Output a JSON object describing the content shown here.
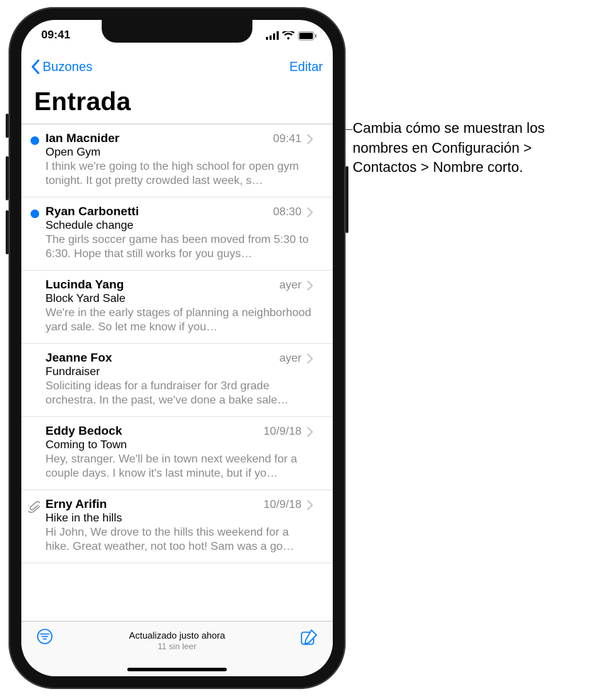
{
  "status": {
    "time": "09:41"
  },
  "nav": {
    "back": "Buzones",
    "edit": "Editar"
  },
  "title": "Entrada",
  "messages": [
    {
      "sender": "Ian Macnider",
      "time": "09:41",
      "subject": "Open Gym",
      "preview": "I think we're going to the high school for open gym tonight. It got pretty crowded last week, s…",
      "unread": true,
      "attachment": false
    },
    {
      "sender": "Ryan Carbonetti",
      "time": "08:30",
      "subject": "Schedule change",
      "preview": "The girls soccer game has been moved from 5:30 to 6:30. Hope that still works for you guys…",
      "unread": true,
      "attachment": false
    },
    {
      "sender": "Lucinda Yang",
      "time": "ayer",
      "subject": "Block Yard Sale",
      "preview": "We're in the early stages of planning a neighborhood yard sale. So let me know if you…",
      "unread": false,
      "attachment": false
    },
    {
      "sender": "Jeanne Fox",
      "time": "ayer",
      "subject": "Fundraiser",
      "preview": "Soliciting ideas for a fundraiser for 3rd grade orchestra. In the past, we've done a bake sale…",
      "unread": false,
      "attachment": false
    },
    {
      "sender": "Eddy Bedock",
      "time": "10/9/18",
      "subject": "Coming to Town",
      "preview": "Hey, stranger. We'll be in town next weekend for a couple days. I know it's last minute, but if yo…",
      "unread": false,
      "attachment": false
    },
    {
      "sender": "Erny Arifin",
      "time": "10/9/18",
      "subject": "Hike in the hills",
      "preview": "Hi John, We drove to the hills this weekend for a hike. Great weather, not too hot! Sam was a go…",
      "unread": false,
      "attachment": true
    }
  ],
  "toolbar": {
    "status": "Actualizado justo ahora",
    "substatus": "11 sin leer"
  },
  "callout": "Cambia cómo se muestran los nombres en Configuración > Contactos > Nombre corto."
}
